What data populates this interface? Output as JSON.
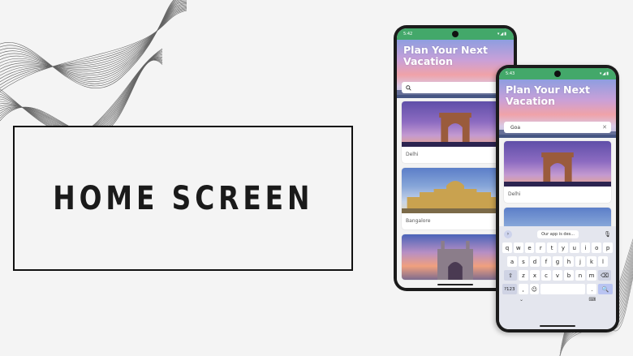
{
  "slide": {
    "title": "HOME SCREEN"
  },
  "app": {
    "status_time_back": "5:42",
    "status_time_front": "5:43",
    "status_icons": "▾◢▮",
    "hero_title": "Plan Your Next Vacation",
    "search_value_back": "",
    "search_value_front": "Goa",
    "cards_back": [
      {
        "label": "Delhi"
      },
      {
        "label": "Bangalore"
      },
      {
        "label": ""
      }
    ],
    "cards_front": [
      {
        "label": "Delhi"
      },
      {
        "label": ""
      }
    ]
  },
  "keyboard": {
    "suggestion": "Our app is des...",
    "row1": [
      "q",
      "w",
      "e",
      "r",
      "t",
      "y",
      "u",
      "i",
      "o",
      "p"
    ],
    "row2": [
      "a",
      "s",
      "d",
      "f",
      "g",
      "h",
      "j",
      "k",
      "l"
    ],
    "row3": [
      "z",
      "x",
      "c",
      "v",
      "b",
      "n",
      "m"
    ],
    "shift_key": "⇧",
    "backspace_key": "⌫",
    "symbols_key": "?123",
    "comma_key": ",",
    "emoji_key": "☺",
    "period_key": ".",
    "enter_key": "🔍",
    "nav_back": "⌄",
    "nav_switch": "⌨"
  },
  "colors": {
    "status_bar": "#43a86a",
    "background": "#f4f4f4"
  }
}
